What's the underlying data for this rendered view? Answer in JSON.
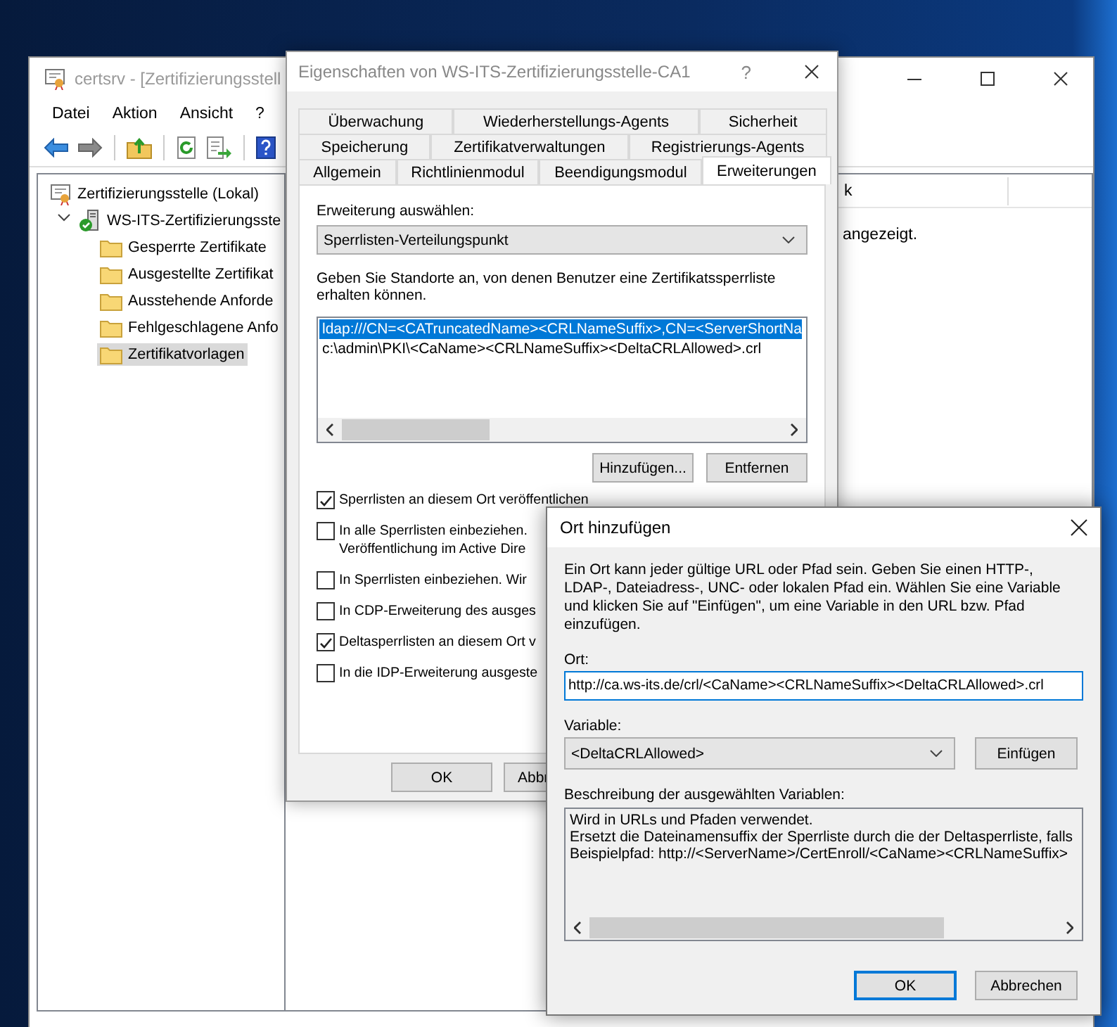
{
  "main_window": {
    "title": "certsrv - [Zertifizierungsstell",
    "menu": [
      "Datei",
      "Aktion",
      "Ansicht",
      "?"
    ],
    "tree": [
      {
        "label": "Zertifizierungsstelle (Lokal)",
        "kind": "root",
        "selected": false,
        "children": [
          {
            "label": "WS-ITS-Zertifizierungsste",
            "kind": "ca",
            "expanded": true,
            "selected": false,
            "children": [
              {
                "label": "Gesperrte Zertifikate",
                "kind": "folder",
                "selected": false
              },
              {
                "label": "Ausgestellte Zertifikat",
                "kind": "folder",
                "selected": false
              },
              {
                "label": "Ausstehende Anforde",
                "kind": "folder",
                "selected": false
              },
              {
                "label": "Fehlgeschlagene Anfo",
                "kind": "folder",
                "selected": false
              },
              {
                "label": "Zertifikatvorlagen",
                "kind": "folder",
                "selected": true
              }
            ]
          }
        ]
      }
    ],
    "column_header": "k",
    "list_message": "angezeigt."
  },
  "properties_dialog": {
    "title": "Eigenschaften von WS-ITS-Zertifizierungsstelle-CA1",
    "help": "?",
    "tab_rows": [
      {
        "tabs": [
          {
            "label": "Überwachung",
            "selected": false
          },
          {
            "label": "Wiederherstellungs-Agents",
            "selected": false
          },
          {
            "label": "Sicherheit",
            "selected": false
          }
        ]
      },
      {
        "tabs": [
          {
            "label": "Speicherung",
            "selected": false
          },
          {
            "label": "Zertifikatverwaltungen",
            "selected": false
          },
          {
            "label": "Registrierungs-Agents",
            "selected": false
          }
        ]
      },
      {
        "tabs": [
          {
            "label": "Allgemein",
            "selected": false
          },
          {
            "label": "Richtlinienmodul",
            "selected": false
          },
          {
            "label": "Beendigungsmodul",
            "selected": false
          },
          {
            "label": "Erweiterungen",
            "selected": true
          }
        ]
      }
    ],
    "extension_label": "Erweiterung auswählen:",
    "extension_value": "Sperrlisten-Verteilungspunkt",
    "hint": "Geben Sie Standorte an, von denen Benutzer eine Zertifikatssperrliste erhalten können.",
    "locations": [
      {
        "text": "ldap:///CN=<CATruncatedName><CRLNameSuffix>,CN=<ServerShortNa",
        "selected": true
      },
      {
        "text": "c:\\admin\\PKI\\<CaName><CRLNameSuffix><DeltaCRLAllowed>.crl",
        "selected": false
      }
    ],
    "add_button": "Hinzufügen...",
    "remove_button": "Entfernen",
    "options": [
      {
        "lines": [
          "Sperrlisten an diesem Ort veröffentlichen"
        ],
        "checked": true
      },
      {
        "lines": [
          "In alle Sperrlisten einbeziehen.",
          "Veröffentlichung im Active Dire"
        ],
        "checked": false
      },
      {
        "lines": [
          "In Sperrlisten einbeziehen. Wir"
        ],
        "checked": false
      },
      {
        "lines": [
          "In CDP-Erweiterung des ausges"
        ],
        "checked": false
      },
      {
        "lines": [
          "Deltasperrlisten an diesem Ort v"
        ],
        "checked": true
      },
      {
        "lines": [
          "In die IDP-Erweiterung ausgeste"
        ],
        "checked": false
      }
    ],
    "buttons": [
      "OK",
      "Abbr"
    ]
  },
  "ort_dialog": {
    "title": "Ort hinzufügen",
    "intro": "Ein Ort kann jeder gültige URL oder Pfad sein. Geben Sie einen HTTP-, LDAP-, Dateiadress-, UNC- oder lokalen Pfad ein. Wählen Sie eine Variable und klicken Sie auf \"Einfügen\", um eine Variable in den URL bzw. Pfad einzufügen.",
    "ort_label": "Ort:",
    "ort_value": "http://ca.ws-its.de/crl/<CaName><CRLNameSuffix><DeltaCRLAllowed>.crl",
    "variable_label": "Variable:",
    "variable_value": "<DeltaCRLAllowed>",
    "insert_button": "Einfügen",
    "description_label": "Beschreibung der ausgewählten Variablen:",
    "description_lines": [
      "Wird in URLs und Pfaden verwendet.",
      "Ersetzt die Dateinamensuffix der Sperrliste durch die der Deltasperrliste, falls",
      "Beispielpfad: http://<ServerName>/CertEnroll/<CaName><CRLNameSuffix>"
    ],
    "buttons": [
      {
        "label": "OK",
        "default": true
      },
      {
        "label": "Abbrechen",
        "default": false
      }
    ]
  }
}
